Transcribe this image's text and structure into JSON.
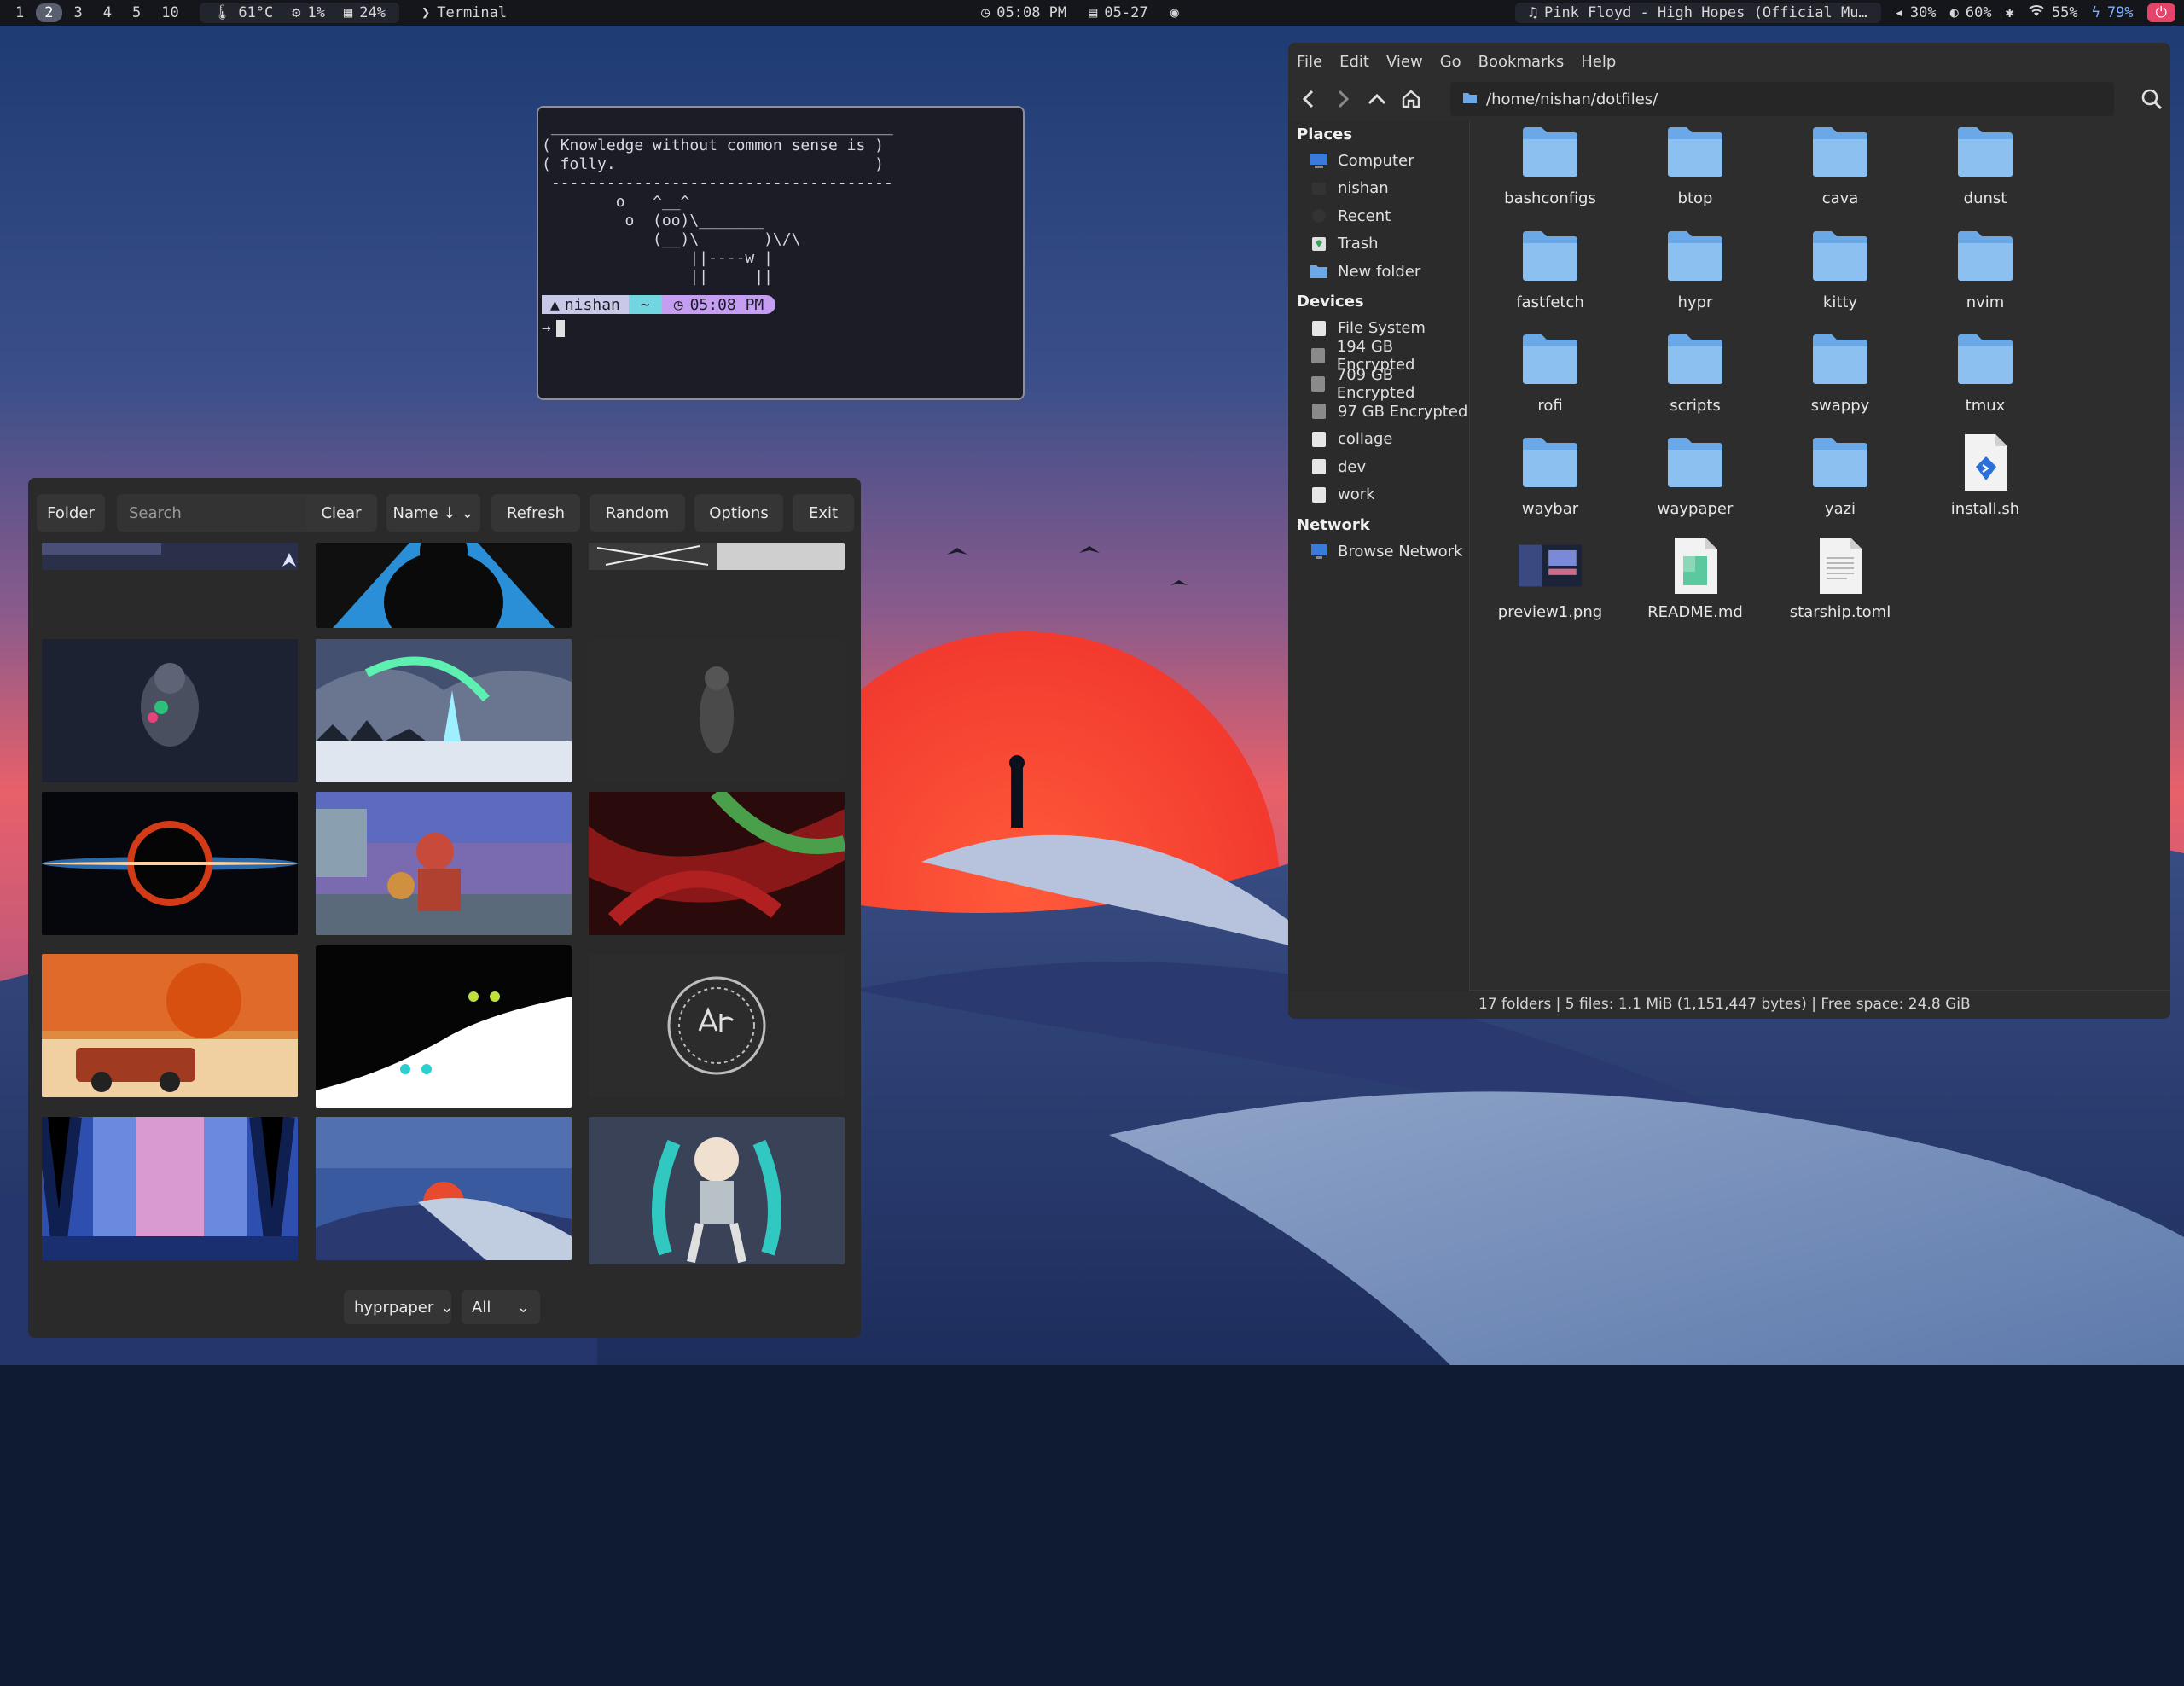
{
  "topbar": {
    "workspaces": [
      "1",
      "2",
      "3",
      "4",
      "5",
      "10"
    ],
    "active_workspace": "2",
    "temperature": "61°C",
    "cpu": "1%",
    "memory": "24%",
    "window_title": "Terminal",
    "time": "05:08 PM",
    "date": "05-27",
    "media": "Pink Floyd - High Hopes (Official Mu…",
    "volume": "30%",
    "brightness": "60%",
    "wifi": "55%",
    "battery": "79%"
  },
  "terminal": {
    "cowsay_top": " _____________________________________",
    "cowsay_line1": "( Knowledge without common sense is )",
    "cowsay_line2": "( folly.                            )",
    "cowsay_bottom": " -------------------------------------",
    "cow_line1": "        o   ^__^",
    "cow_line2": "         o  (oo)\\_______",
    "cow_line3": "            (__)\\       )\\/\\",
    "cow_line4": "                ||----w |",
    "cow_line5": "                ||     ||",
    "prompt_user": "nishan",
    "prompt_dir": "~",
    "prompt_time": "05:08 PM",
    "prompt_arrow": "→"
  },
  "picker": {
    "folder_label": "Folder",
    "search_placeholder": "Search",
    "clear_label": "Clear",
    "sort_label": "Name ↓",
    "refresh_label": "Refresh",
    "random_label": "Random",
    "options_label": "Options",
    "exit_label": "Exit",
    "backend_label": "hyprpaper",
    "filter_label": "All"
  },
  "filemanager": {
    "menu": [
      "File",
      "Edit",
      "View",
      "Go",
      "Bookmarks",
      "Help"
    ],
    "path": "/home/nishan/dotfiles/",
    "places_header": "Places",
    "places": [
      "Computer",
      "nishan",
      "Recent",
      "Trash",
      "New folder"
    ],
    "devices_header": "Devices",
    "devices": [
      "File System",
      "194 GB Encrypted",
      "709 GB Encrypted",
      "97 GB Encrypted",
      "collage",
      "dev",
      "work"
    ],
    "network_header": "Network",
    "network": [
      "Browse Network"
    ],
    "items": [
      {
        "name": "bashconfigs",
        "type": "folder"
      },
      {
        "name": "btop",
        "type": "folder"
      },
      {
        "name": "cava",
        "type": "folder"
      },
      {
        "name": "dunst",
        "type": "folder"
      },
      {
        "name": "fastfetch",
        "type": "folder"
      },
      {
        "name": "hypr",
        "type": "folder"
      },
      {
        "name": "kitty",
        "type": "folder"
      },
      {
        "name": "nvim",
        "type": "folder"
      },
      {
        "name": "rofi",
        "type": "folder"
      },
      {
        "name": "scripts",
        "type": "folder"
      },
      {
        "name": "swappy",
        "type": "folder"
      },
      {
        "name": "tmux",
        "type": "folder"
      },
      {
        "name": "waybar",
        "type": "folder"
      },
      {
        "name": "waypaper",
        "type": "folder"
      },
      {
        "name": "yazi",
        "type": "folder"
      },
      {
        "name": "install.sh",
        "type": "script"
      },
      {
        "name": "preview1.png",
        "type": "image"
      },
      {
        "name": "README.md",
        "type": "markdown"
      },
      {
        "name": "starship.toml",
        "type": "text"
      }
    ],
    "status": "17 folders  |  5 files: 1.1 MiB (1,151,447 bytes)  |  Free space: 24.8 GiB"
  },
  "colors": {
    "folder": "#6aa8e8",
    "accent_power": "#e6436b",
    "prompt_cyan": "#71d6e0",
    "prompt_violet": "#c59ef2"
  }
}
